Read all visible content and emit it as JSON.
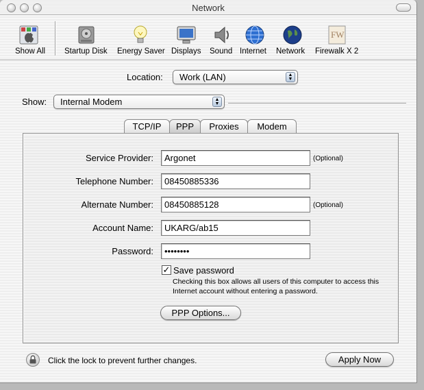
{
  "window": {
    "title": "Network"
  },
  "toolbar": {
    "items": [
      {
        "label": "Show All",
        "icon": "apple-grid-icon"
      },
      {
        "label": "Startup Disk",
        "icon": "hard-disk-icon"
      },
      {
        "label": "Energy Saver",
        "icon": "lightbulb-icon"
      },
      {
        "label": "Displays",
        "icon": "monitor-icon"
      },
      {
        "label": "Sound",
        "icon": "speaker-icon"
      },
      {
        "label": "Internet",
        "icon": "globe-icon"
      },
      {
        "label": "Network",
        "icon": "globe-icon"
      },
      {
        "label": "Firewalk X 2",
        "icon": "fw-icon"
      }
    ]
  },
  "location": {
    "label": "Location:",
    "value": "Work (LAN)"
  },
  "show": {
    "label": "Show:",
    "value": "Internal Modem"
  },
  "tabs": [
    {
      "label": "TCP/IP",
      "active": false
    },
    {
      "label": "PPP",
      "active": true
    },
    {
      "label": "Proxies",
      "active": false
    },
    {
      "label": "Modem",
      "active": false
    }
  ],
  "form": {
    "service_provider": {
      "label": "Service Provider:",
      "value": "Argonet",
      "note": "(Optional)"
    },
    "telephone_number": {
      "label": "Telephone Number:",
      "value": "08450885336"
    },
    "alternate_number": {
      "label": "Alternate Number:",
      "value": "08450885128",
      "note": "(Optional)"
    },
    "account_name": {
      "label": "Account Name:",
      "value": "UKARG/ab15"
    },
    "password": {
      "label": "Password:",
      "value": "••••••••"
    },
    "save_password": {
      "label": "Save password",
      "checked": true,
      "mark": "✓",
      "help": "Checking this box allows all users of this computer to access this Internet account without entering a password."
    },
    "ppp_options_label": "PPP Options..."
  },
  "footer": {
    "lock_text": "Click the lock to prevent further changes.",
    "apply_label": "Apply Now"
  }
}
